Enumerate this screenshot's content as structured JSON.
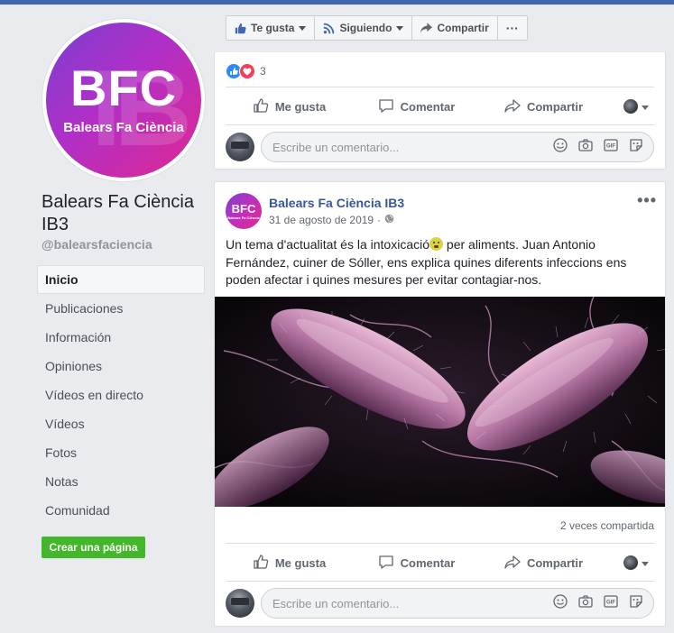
{
  "page": {
    "name": "Balears Fa Ciència IB3",
    "handle": "@balearsfaciencia",
    "logo_text": "BFC",
    "logo_subtext": "Balears Fa Ciència"
  },
  "sidebar": {
    "items": [
      {
        "label": "Inicio",
        "active": true
      },
      {
        "label": "Publicaciones"
      },
      {
        "label": "Información"
      },
      {
        "label": "Opiniones"
      },
      {
        "label": "Vídeos en directo"
      },
      {
        "label": "Vídeos"
      },
      {
        "label": "Fotos"
      },
      {
        "label": "Notas"
      },
      {
        "label": "Comunidad"
      }
    ],
    "create_page": "Crear una página"
  },
  "actionbar": {
    "like": "Te gusta",
    "following": "Siguiendo",
    "share": "Compartir",
    "more": "···"
  },
  "post1": {
    "reaction_count": "3",
    "actions": {
      "like": "Me gusta",
      "comment": "Comentar",
      "share": "Compartir"
    },
    "comment_placeholder": "Escribe un comentario..."
  },
  "post2": {
    "author": "Balears Fa Ciència IB3",
    "date": "31 de agosto de 2019",
    "separator": "·",
    "text_before_emoji": "Un tema d'actualitat és la intoxicació",
    "text_after_emoji": " per aliments. Juan Antonio Fernández, cuiner de Sóller, ens explica quines diferents infeccions ens poden afectar i quines mesures per evitar contagiar-nos.",
    "more": "•••",
    "shares": "2 veces compartida",
    "actions": {
      "like": "Me gusta",
      "comment": "Comentar",
      "share": "Compartir"
    },
    "comment_placeholder": "Escribe un comentario..."
  },
  "colors": {
    "facebook_blue": "#4267b2",
    "link_blue": "#365899",
    "green_button": "#42b72a",
    "background": "#e9ebee",
    "logo_gradient_start": "#7a3fd0",
    "logo_gradient_end": "#e0288f"
  },
  "icons": [
    "thumbs-up-icon",
    "rss-icon",
    "share-arrow-icon",
    "comment-icon",
    "globe-icon",
    "smiley-icon",
    "camera-icon",
    "gif-icon",
    "sticker-icon",
    "chevron-down-icon",
    "heart-icon"
  ]
}
